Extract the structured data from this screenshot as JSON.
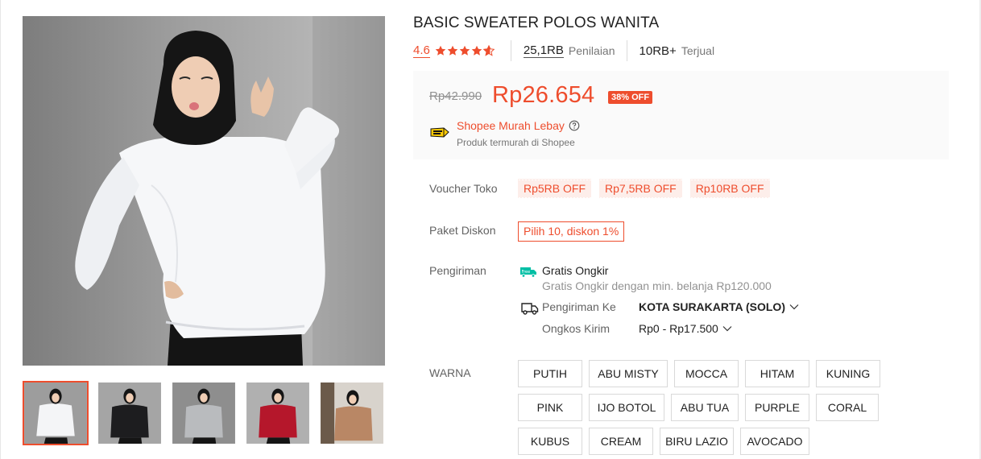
{
  "product": {
    "title": "BASIC SWEATER POLOS WANITA",
    "rating": "4.6",
    "rating_stars": 4.6,
    "ratings_count": "25,1RB",
    "ratings_label": "Penilaian",
    "sold_count": "10RB+",
    "sold_label": "Terjual"
  },
  "price": {
    "original": "Rp42.990",
    "current": "Rp26.654",
    "discount": "38% OFF",
    "promo_name": "Shopee Murah Lebay",
    "promo_desc": "Produk termurah di Shopee",
    "promo_icon": "shopee-murah-lebay-icon",
    "help_icon": "question-circle-icon"
  },
  "voucher": {
    "label": "Voucher Toko",
    "items": [
      "Rp5RB OFF",
      "Rp7,5RB OFF",
      "Rp10RB OFF"
    ]
  },
  "bundle": {
    "label": "Paket Diskon",
    "text": "Pilih 10, diskon 1%"
  },
  "shipping": {
    "label": "Pengiriman",
    "free_icon": "free-shipping-icon",
    "free_title": "Gratis Ongkir",
    "free_desc": "Gratis Ongkir dengan min. belanja Rp120.000",
    "truck_icon": "truck-icon",
    "to_label": "Pengiriman Ke",
    "to_value": "KOTA SURAKARTA (SOLO)",
    "cost_label": "Ongkos Kirim",
    "cost_value": "Rp0 - Rp17.500"
  },
  "variation": {
    "label": "WARNA",
    "options": [
      "PUTIH",
      "ABU MISTY",
      "MOCCA",
      "HITAM",
      "KUNING",
      "PINK",
      "IJO BOTOL",
      "ABU TUA",
      "PURPLE",
      "CORAL",
      "KUBUS",
      "CREAM",
      "BIRU LAZIO",
      "AVOCADO"
    ]
  },
  "gallery": {
    "thumbnails": [
      {
        "color": "#f4f5f7",
        "selected": true
      },
      {
        "color": "#1d1d1f",
        "selected": false
      },
      {
        "color": "#b9bbbe",
        "selected": false
      },
      {
        "color": "#b5172b",
        "selected": false
      },
      {
        "color": "#b98765",
        "selected": false
      }
    ]
  },
  "colors": {
    "accent": "#ee4d2d",
    "badge_bg": "#ee4d2d",
    "voucher_bg": "#fdeeea",
    "price_box_bg": "#fafafa",
    "free_ship": "#00bfa5"
  }
}
